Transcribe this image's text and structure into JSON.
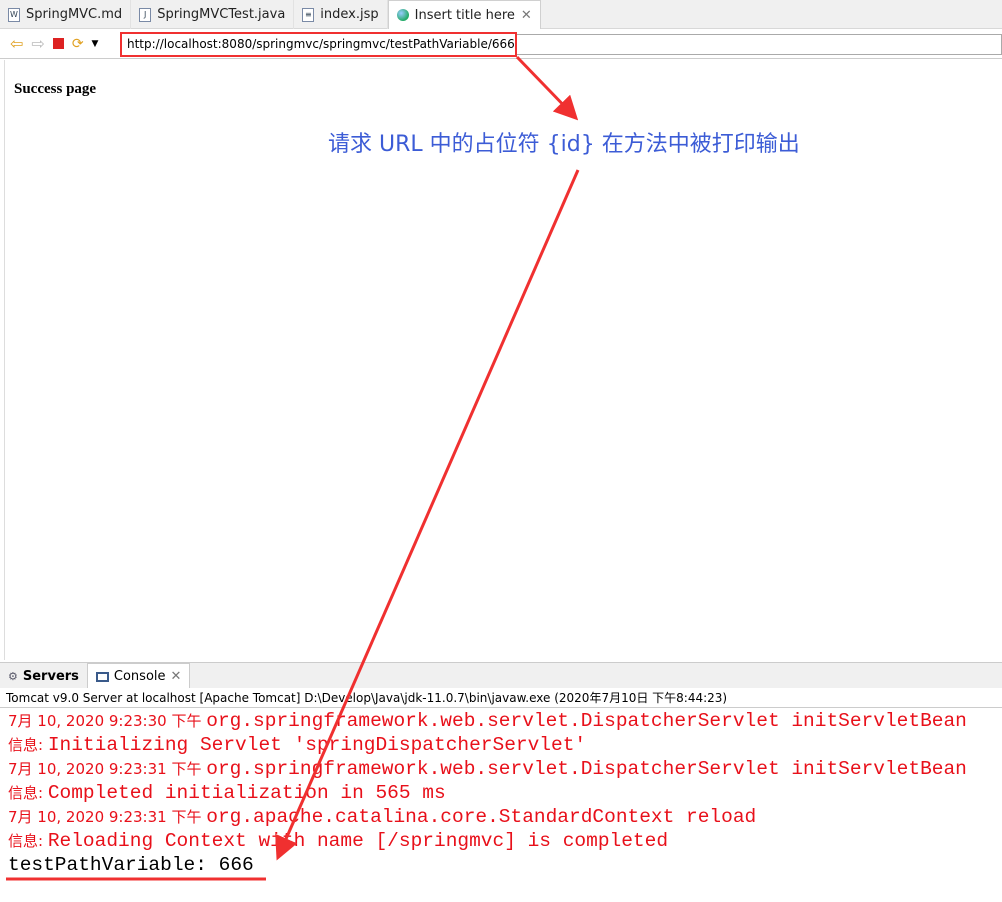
{
  "editor_tabs": [
    {
      "label": "SpringMVC.md",
      "icon": "word-doc-icon"
    },
    {
      "label": "SpringMVCTest.java",
      "icon": "java-file-icon"
    },
    {
      "label": "index.jsp",
      "icon": "jsp-file-icon"
    },
    {
      "label": "Insert title here",
      "icon": "globe-icon",
      "active": true
    }
  ],
  "browser": {
    "url": "http://localhost:8080/springmvc/springmvc/testPathVariable/666",
    "page_text": "Success page"
  },
  "annotation": {
    "text": "请求 URL 中的占位符 {id} 在方法中被打印输出",
    "color": "#3c5cd6"
  },
  "views": [
    {
      "label": "Servers"
    },
    {
      "label": "Console"
    }
  ],
  "console": {
    "header": "Tomcat v9.0 Server at localhost [Apache Tomcat] D:\\Develop\\Java\\jdk-11.0.7\\bin\\javaw.exe  (2020年7月10日 下午8:44:23)",
    "lines": [
      {
        "prefix": "7月 10, 2020 9:23:30 下午 ",
        "text": "org.springframework.web.servlet.DispatcherServlet initServletBean"
      },
      {
        "prefix": "信息: ",
        "text": "Initializing Servlet 'springDispatcherServlet'"
      },
      {
        "prefix": "7月 10, 2020 9:23:31 下午 ",
        "text": "org.springframework.web.servlet.DispatcherServlet initServletBean"
      },
      {
        "prefix": "信息: ",
        "text": "Completed initialization in 565 ms"
      },
      {
        "prefix": "7月 10, 2020 9:23:31 下午 ",
        "text": "org.apache.catalina.core.StandardContext reload"
      },
      {
        "prefix": "信息: ",
        "text": "Reloading Context with name [/springmvc] is completed"
      }
    ],
    "output": "testPathVariable: 666"
  }
}
